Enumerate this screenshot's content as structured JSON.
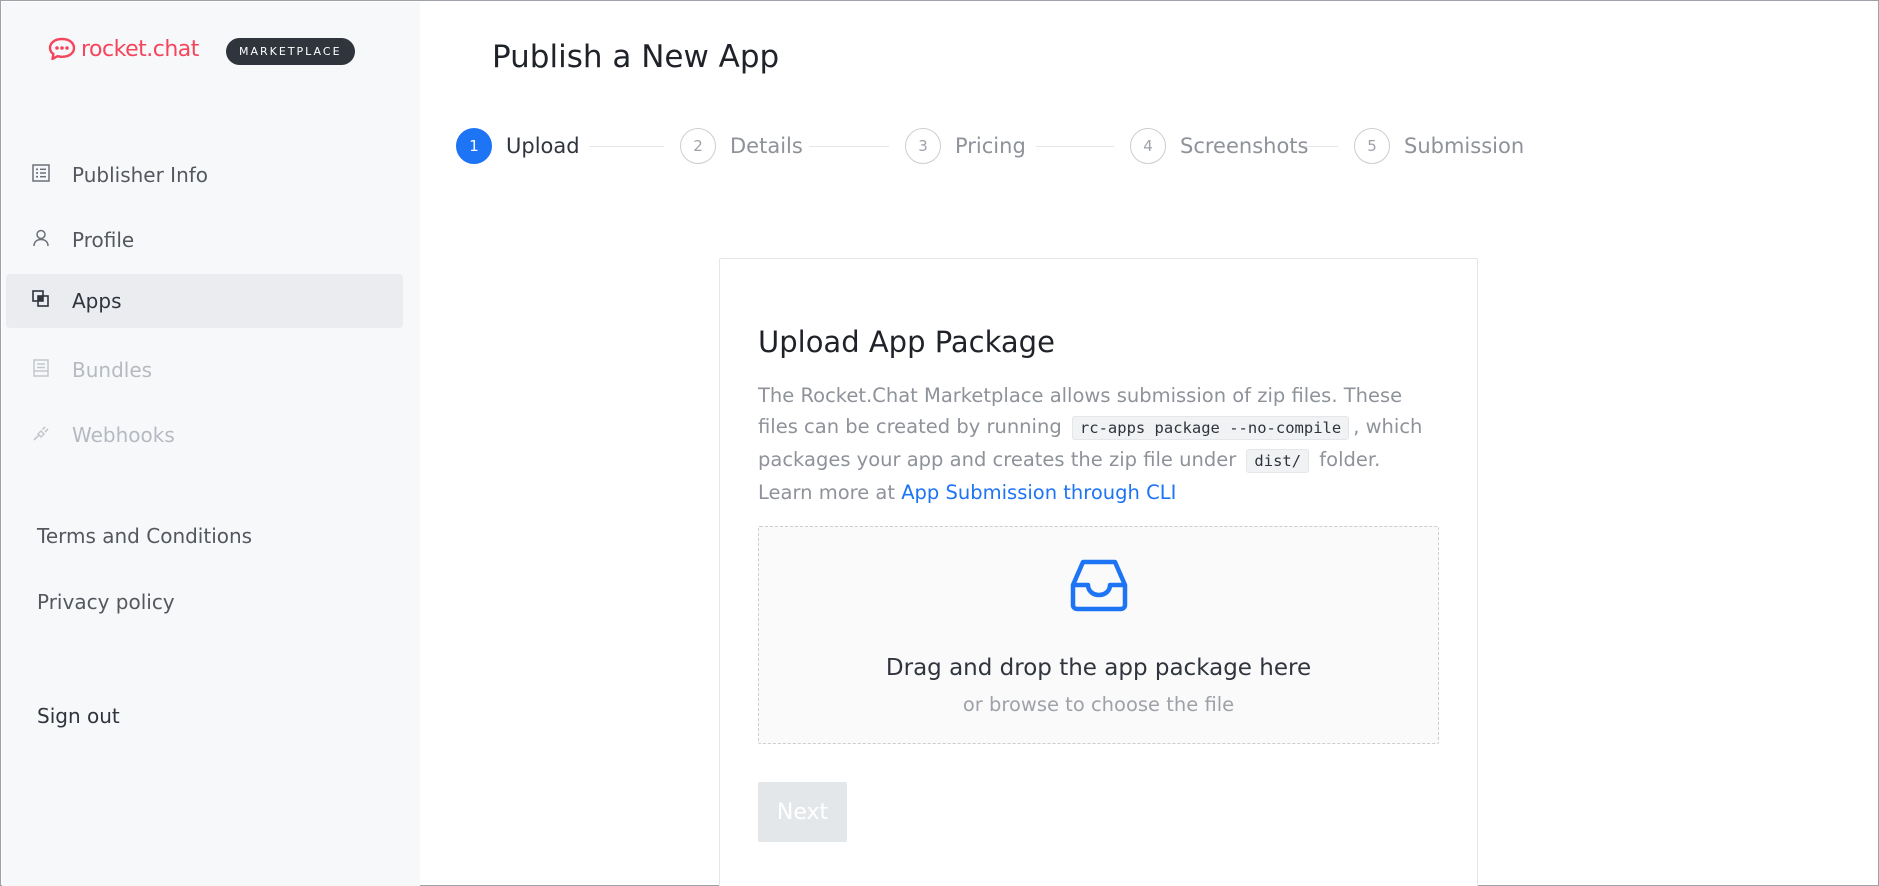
{
  "brand": {
    "name": "rocket.chat",
    "badge": "MARKETPLACE",
    "color": "#f5455c"
  },
  "sidebar": {
    "items": [
      {
        "label": "Publisher Info",
        "icon": "list-icon",
        "state": "normal"
      },
      {
        "label": "Profile",
        "icon": "user-icon",
        "state": "normal"
      },
      {
        "label": "Apps",
        "icon": "apps-icon",
        "state": "active"
      },
      {
        "label": "Bundles",
        "icon": "bundle-icon",
        "state": "disabled"
      },
      {
        "label": "Webhooks",
        "icon": "webhook-icon",
        "state": "disabled"
      }
    ],
    "links": {
      "terms": "Terms and Conditions",
      "privacy": "Privacy policy",
      "signout": "Sign out"
    }
  },
  "page": {
    "title": "Publish a New App"
  },
  "stepper": {
    "steps": [
      {
        "number": "1",
        "label": "Upload",
        "status": "current"
      },
      {
        "number": "2",
        "label": "Details",
        "status": "pending"
      },
      {
        "number": "3",
        "label": "Pricing",
        "status": "pending"
      },
      {
        "number": "4",
        "label": "Screenshots",
        "status": "pending"
      },
      {
        "number": "5",
        "label": "Submission",
        "status": "pending"
      }
    ]
  },
  "upload": {
    "title": "Upload App Package",
    "desc_1": "The Rocket.Chat Marketplace allows submission of zip files. These files can be created by running",
    "code_1": "rc-apps package --no-compile",
    "desc_2": ", which packages your app and creates the zip file under",
    "code_2": "dist/",
    "desc_3": "folder.",
    "learn_prefix": "Learn more at",
    "learn_link": "App Submission through CLI",
    "drop_title": "Drag and drop the app package here",
    "drop_sub": "or browse to choose the file",
    "drop_icon": "inbox-icon",
    "next_label": "Next",
    "next_enabled": false
  },
  "colors": {
    "accent": "#1d74f5",
    "sidebar_bg": "#f7f8fa"
  }
}
